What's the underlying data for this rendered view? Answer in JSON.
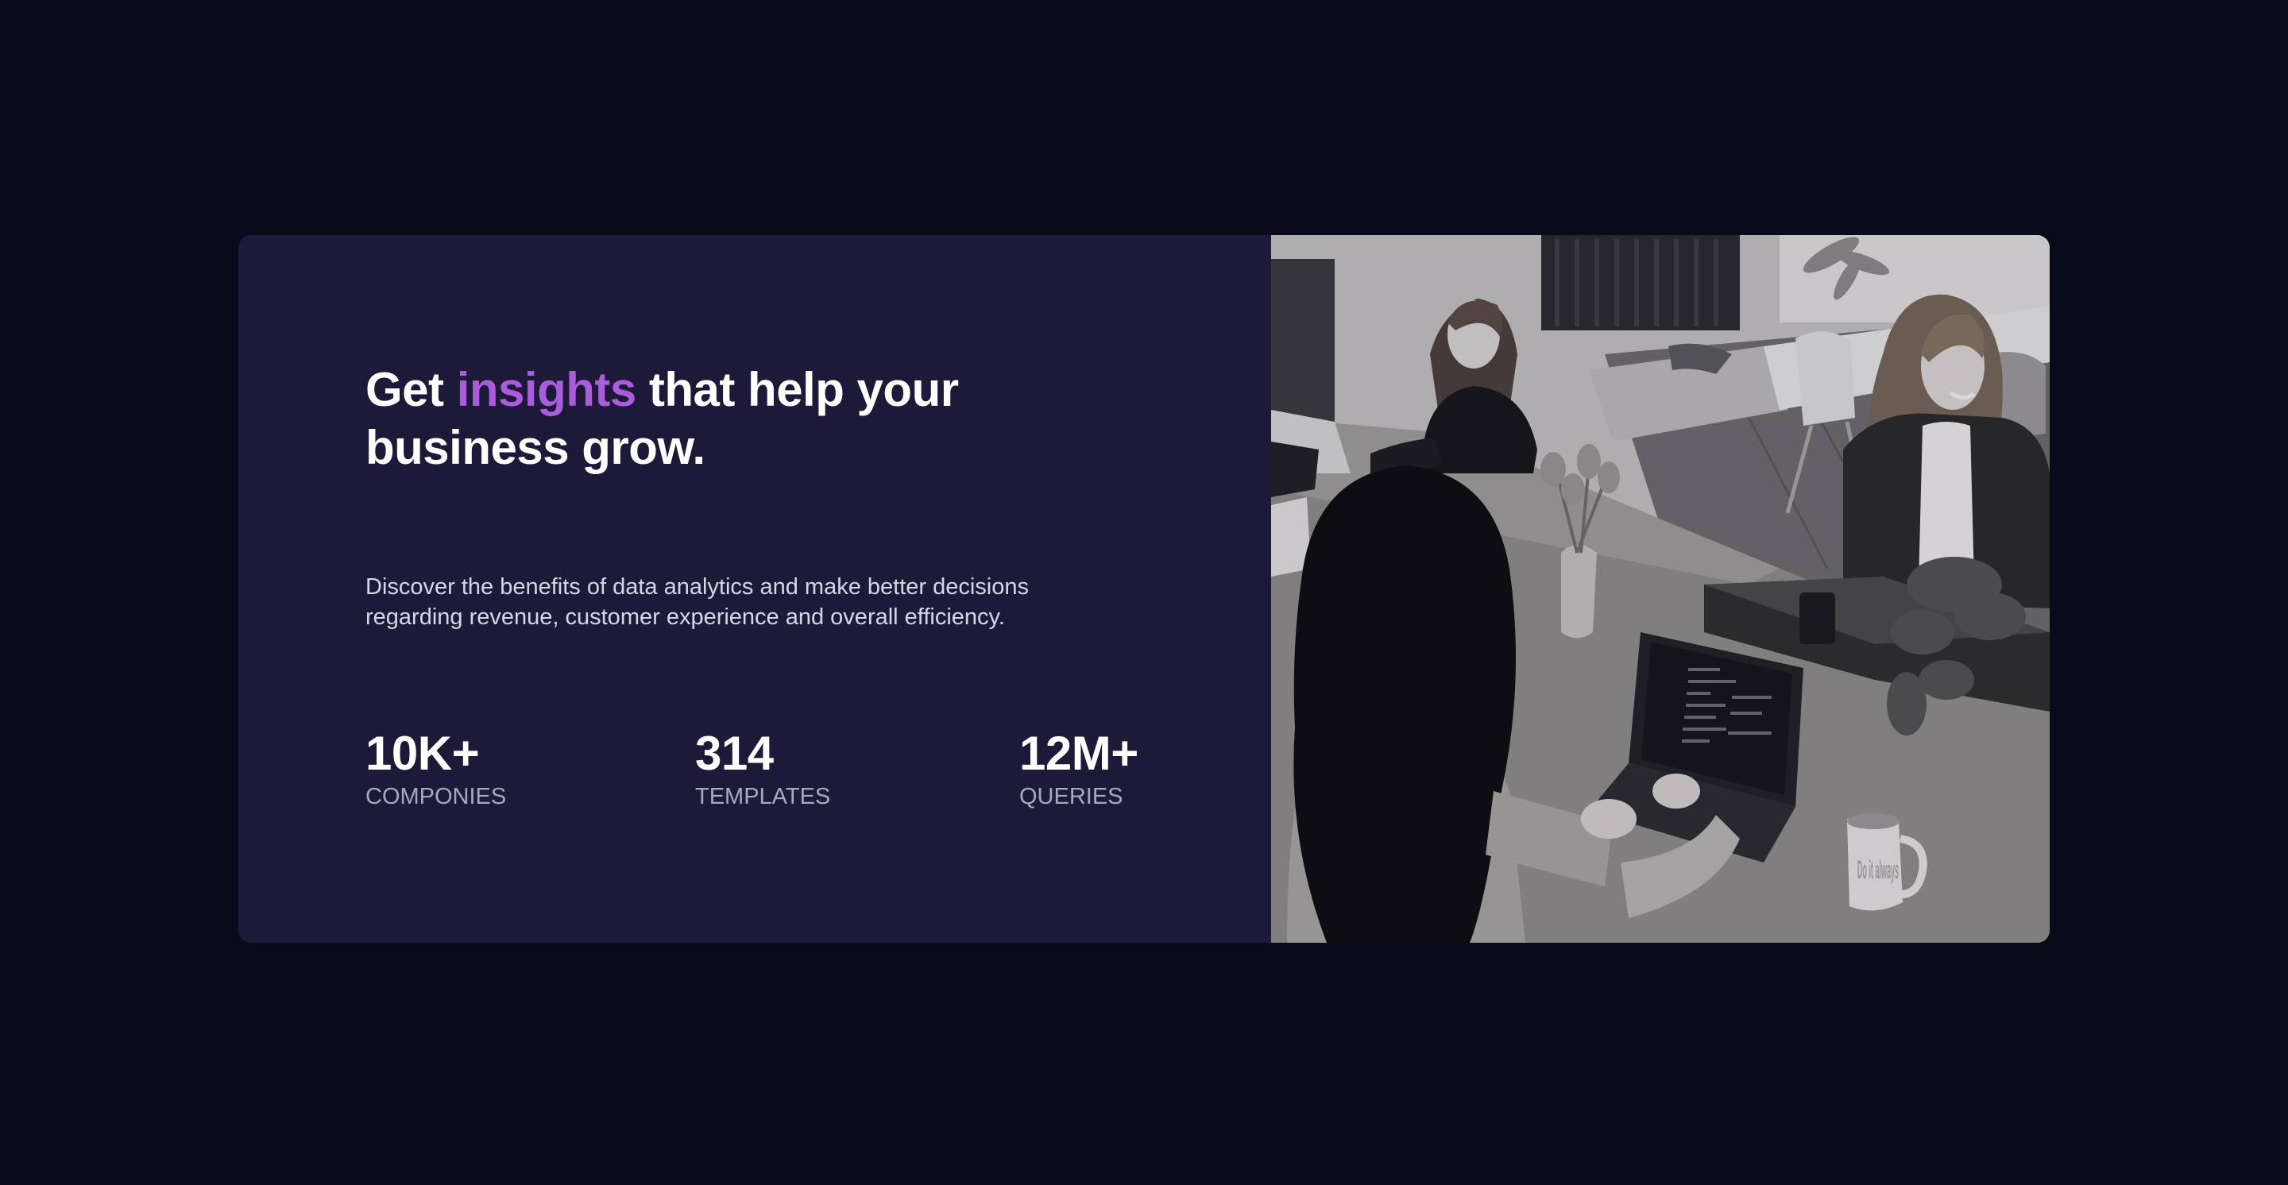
{
  "hero": {
    "heading_prefix": "Get ",
    "heading_accent": "insights",
    "heading_suffix": " that help your business grow.",
    "description": "Discover the benefits of data analytics and make better decisions regarding revenue, customer experience and overall efficiency.",
    "stats": [
      {
        "value": "10K+",
        "label": "COMPONIES"
      },
      {
        "value": "314",
        "label": "TEMPLATES"
      },
      {
        "value": "12M+",
        "label": "QUERIES"
      }
    ],
    "mug_text": "Do it always"
  },
  "colors": {
    "page_background": "#090b1b",
    "card_background": "#1c1a38",
    "accent": "#aa5cdb",
    "text_primary": "#ffffff",
    "text_secondary": "#d8d6e6",
    "text_muted": "#a9a8bd"
  }
}
